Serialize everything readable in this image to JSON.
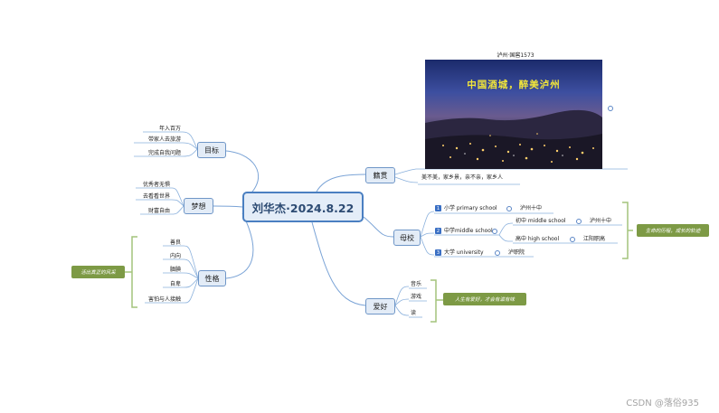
{
  "central": "刘华杰·2024.8.22",
  "left": {
    "goal": {
      "label": "目标",
      "items": [
        "年入百万",
        "带家人去旅游",
        "完成自我问题"
      ]
    },
    "dream": {
      "label": "梦想",
      "items": [
        "优秀者无惧",
        "去看看世界",
        "财富自由"
      ]
    },
    "personality": {
      "label": "性格",
      "items": [
        "善良",
        "内向",
        "腼腆",
        "自卑",
        "害怕与人接触"
      ],
      "note": "活出真正的风采"
    }
  },
  "right": {
    "hometown": {
      "label": "籍贯",
      "image_caption": "泸州·国窖1573",
      "image_title": "中国酒城，醉美泸州",
      "desc": "美不美，家乡景，亲不亲，家乡人"
    },
    "school": {
      "label": "母校",
      "note": "生命的历程，成长的轨迹",
      "items": [
        {
          "num": "1",
          "label": "小学 primary school",
          "value": "泸州十中"
        },
        {
          "num": "2",
          "label": "中学middle school",
          "children": [
            {
              "label": "初中 middle school",
              "value": "泸州十中"
            },
            {
              "label": "高中 high school",
              "value": "江阳职高"
            }
          ]
        },
        {
          "num": "3",
          "label": "大学    university",
          "value": "泸职院"
        }
      ]
    },
    "hobby": {
      "label": "爱好",
      "items": [
        "音乐",
        "游戏",
        "读"
      ],
      "note": "人生有爱好，才会有滋有味"
    }
  },
  "watermark": "CSDN @落俗935"
}
